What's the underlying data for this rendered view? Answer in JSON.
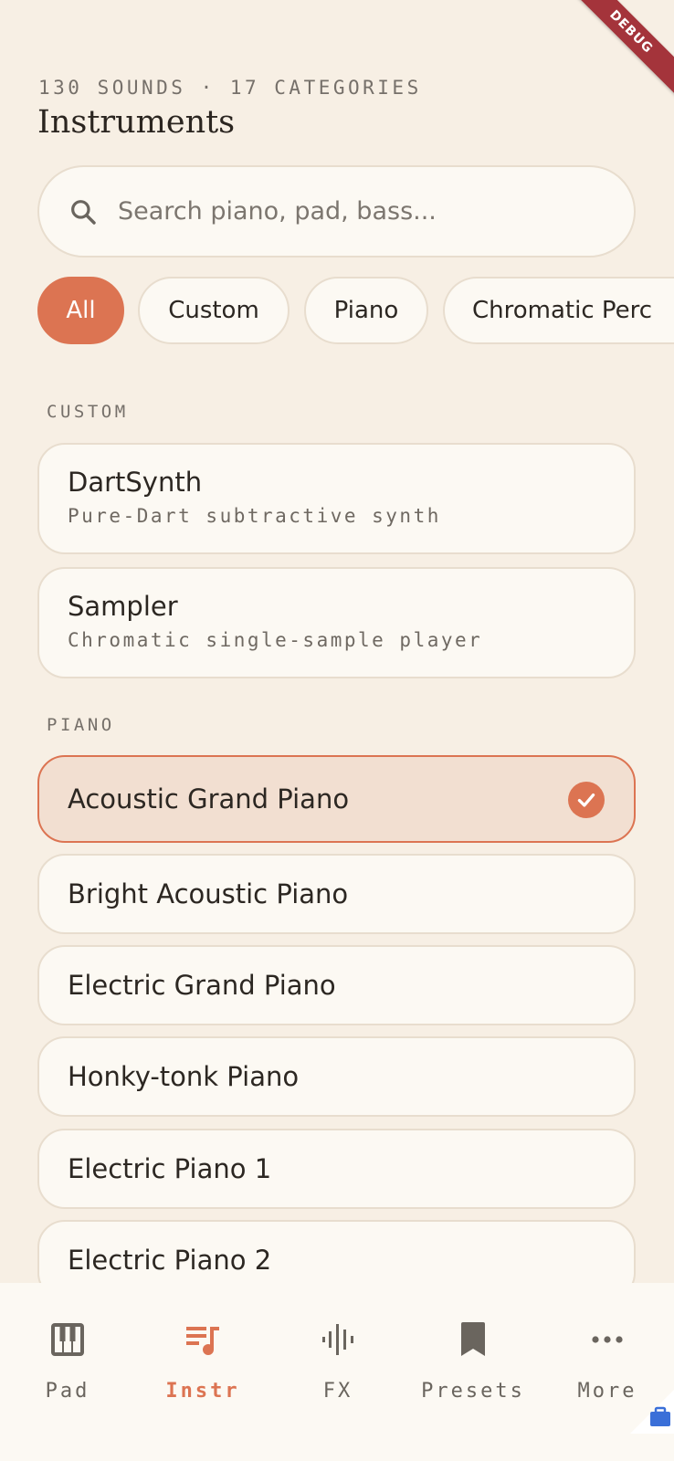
{
  "header": {
    "subtitle": "130 SOUNDS · 17 CATEGORIES",
    "title": "Instruments"
  },
  "search": {
    "placeholder": "Search piano, pad, bass...",
    "value": ""
  },
  "filters": {
    "chips": [
      {
        "label": "All",
        "active": true
      },
      {
        "label": "Custom",
        "active": false
      },
      {
        "label": "Piano",
        "active": false
      },
      {
        "label": "Chromatic Perc",
        "active": false
      }
    ]
  },
  "sections": [
    {
      "label": "CUSTOM",
      "items": [
        {
          "name": "DartSynth",
          "description": "Pure-Dart subtractive synth"
        },
        {
          "name": "Sampler",
          "description": "Chromatic single-sample player"
        }
      ]
    },
    {
      "label": "PIANO",
      "items": [
        {
          "name": "Acoustic Grand Piano",
          "selected": true
        },
        {
          "name": "Bright Acoustic Piano"
        },
        {
          "name": "Electric Grand Piano"
        },
        {
          "name": "Honky-tonk Piano"
        },
        {
          "name": "Electric Piano 1"
        },
        {
          "name": "Electric Piano 2"
        }
      ]
    }
  ],
  "nav": {
    "items": [
      {
        "label": "Pad",
        "icon": "piano-keys-icon",
        "active": false
      },
      {
        "label": "Instr",
        "icon": "music-list-icon",
        "active": true
      },
      {
        "label": "FX",
        "icon": "waveform-icon",
        "active": false
      },
      {
        "label": "Presets",
        "icon": "bookmark-icon",
        "active": false
      },
      {
        "label": "More",
        "icon": "more-dots-icon",
        "active": false
      }
    ]
  },
  "debug_banner": "DEBUG",
  "colors": {
    "background": "#f7efe4",
    "surface": "#fcf9f3",
    "accent": "#dc7452",
    "selected_bg": "#f2dfd1",
    "border": "#e8ddce"
  }
}
